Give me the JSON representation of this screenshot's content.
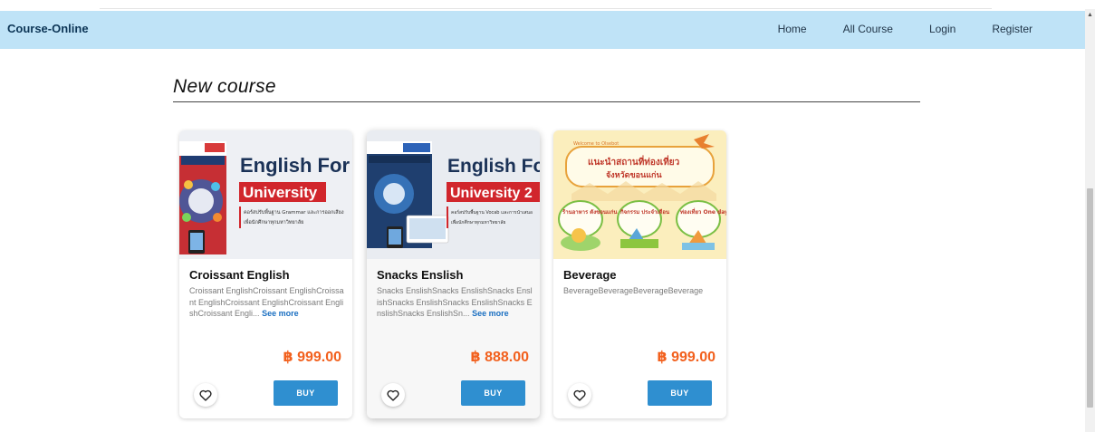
{
  "nav": {
    "brand": "Course-Online",
    "links": [
      "Home",
      "All Course",
      "Login",
      "Register"
    ]
  },
  "section": {
    "title": "New course"
  },
  "courses": [
    {
      "image_text": [
        "English For",
        "University",
        "คอร์สปรับพื้นฐาน Grammar และการออกเสียง",
        "เพื่อนักศึกษาทุกมหาวิทยาลัย"
      ],
      "title": "Croissant English",
      "description": "Croissant EnglishCroissant EnglishCroissant EnglishCroissant EnglishCroissant EnglishCroissant Engli...",
      "see_more": "See more",
      "price": "฿ 999.00",
      "buy": "BUY"
    },
    {
      "image_text": [
        "English Fo",
        "University 2",
        "คอร์สปรับพื้นฐาน Vocab และการนำเสนอ",
        "เพื่อนักศึกษาทุกมหาวิทยาลัย"
      ],
      "title": "Snacks Enslish",
      "description": "Snacks EnslishSnacks EnslishSnacks EnslishSnacks EnslishSnacks EnslishSnacks EnslishSnacks EnslishSn...",
      "see_more": "See more",
      "price": "฿ 888.00",
      "buy": "BUY"
    },
    {
      "image_text": [
        "Welcome to Olsebot",
        "แนะนำสถานที่ท่องเที่ยว",
        "จังหวัดขอนแก่น",
        "ร้านอาหาร ดังขอนแก่น",
        "กิจกรรม ประจำเดือน",
        "ท่องเที่ยว One day trip"
      ],
      "title": "Beverage",
      "description": "BeverageBeverageBeverageBeverage",
      "see_more": "",
      "price": "฿ 999.00",
      "buy": "BUY"
    }
  ],
  "colors": {
    "navbar": "#bfe3f7",
    "price": "#f2601d",
    "buy_button": "#2f8fd0",
    "link": "#1a6fc1"
  },
  "icons": {
    "favorite": "heart-outline-icon",
    "scroll_up": "scroll-up-arrow-icon"
  }
}
